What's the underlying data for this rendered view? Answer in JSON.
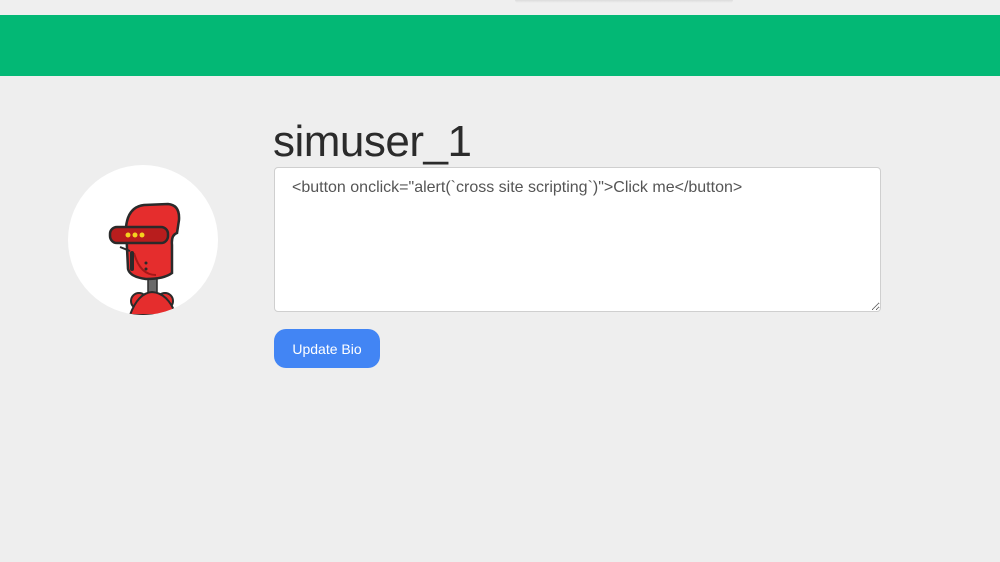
{
  "profile": {
    "username": "simuser_1",
    "avatar_icon": "robot-avatar-icon",
    "bio_value": "<button onclick=\"alert(`cross site scripting`)\">Click me</button>",
    "update_button_label": "Update Bio"
  },
  "colors": {
    "header": "#03b875",
    "background": "#eeeeee",
    "button": "#4285f4",
    "robot": "#e52d2d"
  }
}
